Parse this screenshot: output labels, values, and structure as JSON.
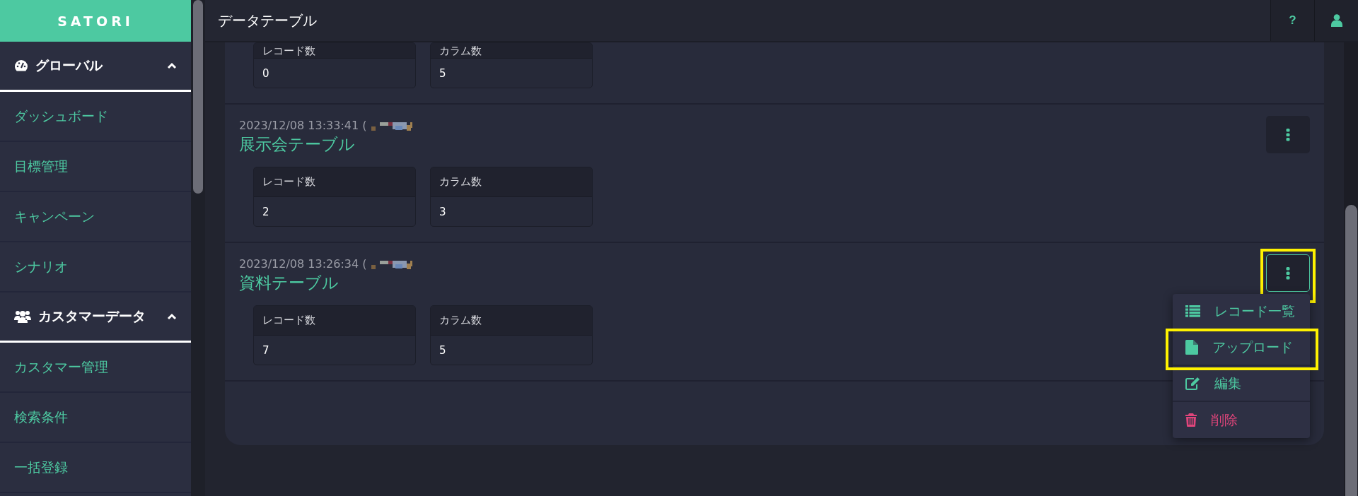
{
  "brand": "SATORI",
  "header": {
    "title": "データテーブル",
    "buttons": [
      {
        "kind": "help",
        "label": "?"
      },
      {
        "kind": "user"
      }
    ]
  },
  "sidebar": {
    "groups": [
      {
        "label": "グローバル",
        "expanded": true,
        "items": [
          {
            "label": "ダッシュボード"
          },
          {
            "label": "目標管理"
          },
          {
            "label": "キャンペーン"
          },
          {
            "label": "シナリオ"
          }
        ]
      },
      {
        "label": "カスタマーデータ",
        "expanded": true,
        "items": [
          {
            "label": "カスタマー管理"
          },
          {
            "label": "検索条件"
          },
          {
            "label": "一括登録"
          }
        ]
      }
    ]
  },
  "rows": [
    {
      "stats": [
        {
          "label": "レコード数",
          "value": "0"
        },
        {
          "label": "カラム数",
          "value": "5"
        }
      ]
    },
    {
      "timestamp": "2023/12/08 13:33:41 (",
      "title": "展示会テーブル",
      "stats": [
        {
          "label": "レコード数",
          "value": "2"
        },
        {
          "label": "カラム数",
          "value": "3"
        }
      ],
      "menu_button": {
        "active": false
      }
    },
    {
      "timestamp": "2023/12/08 13:26:34 (",
      "title": "資料テーブル",
      "stats": [
        {
          "label": "レコード数",
          "value": "7"
        },
        {
          "label": "カラム数",
          "value": "5"
        }
      ],
      "menu_button": {
        "active": true,
        "highlighted": true
      },
      "menu": [
        {
          "kind": "list",
          "label": "レコード一覧"
        },
        {
          "kind": "upload",
          "label": "アップロード",
          "highlighted": true
        },
        {
          "kind": "edit",
          "label": "編集"
        },
        {
          "kind": "delete",
          "label": "削除"
        }
      ]
    }
  ]
}
